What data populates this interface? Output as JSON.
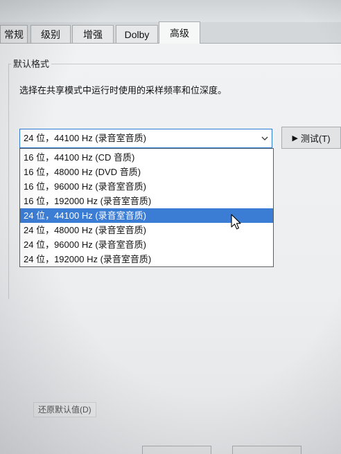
{
  "tabs": [
    {
      "label": "常规"
    },
    {
      "label": "级别"
    },
    {
      "label": "增强"
    },
    {
      "label": "Dolby"
    },
    {
      "label": "高级"
    }
  ],
  "selected_tab_index": 4,
  "default_format": {
    "group_title": "默认格式",
    "description": "选择在共享模式中运行时使用的采样频率和位深度。",
    "selected_value": "24 位，44100 Hz (录音室音质)",
    "test_button_label": "测试(T)",
    "options": [
      "16 位，44100 Hz (CD 音质)",
      "16 位，48000 Hz (DVD 音质)",
      "16 位，96000 Hz (录音室音质)",
      "16 位，192000 Hz (录音室音质)",
      "24 位，44100 Hz (录音室音质)",
      "24 位，48000 Hz (录音室音质)",
      "24 位，96000 Hz (录音室音质)",
      "24 位，192000 Hz (录音室音质)"
    ],
    "highlighted_index": 4
  },
  "restore_defaults_label": "还原默认值(D)",
  "icons": {
    "combo": "chevron-down-icon",
    "test": "play-icon",
    "pointer": "mouse-cursor-icon"
  },
  "colors": {
    "focus_border": "#2c7ad6",
    "selection": "#3b7cd4"
  }
}
